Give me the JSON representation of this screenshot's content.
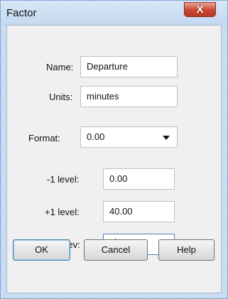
{
  "window": {
    "title": "Factor",
    "close_glyph": "X"
  },
  "fields": {
    "name": {
      "label": "Name:",
      "value": "Departure"
    },
    "units": {
      "label": "Units:",
      "value": "minutes"
    },
    "format": {
      "label": "Format:",
      "value": "0.00"
    },
    "low_level": {
      "label": "-1 level:",
      "value": "0.00"
    },
    "high_level": {
      "label": "+1 level:",
      "value": "40.00"
    },
    "std_dev": {
      "label": "Std dev:",
      "value": "5"
    }
  },
  "buttons": {
    "ok": "OK",
    "cancel": "Cancel",
    "help": "Help"
  }
}
